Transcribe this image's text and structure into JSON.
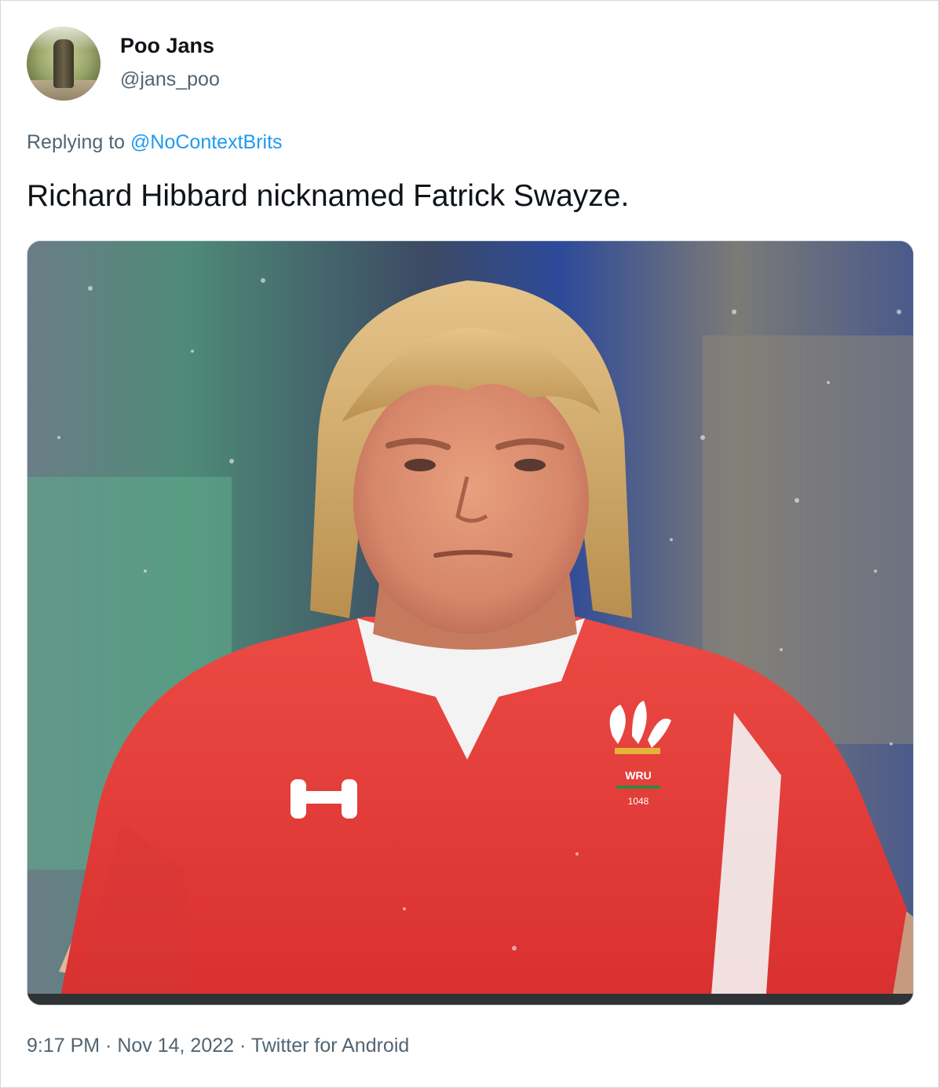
{
  "tweet": {
    "author": {
      "display_name": "Poo Jans",
      "handle": "@jans_poo"
    },
    "reply": {
      "prefix": "Replying to ",
      "mention": "@NoContextBrits"
    },
    "text": "Richard Hibbard nicknamed Fatrick Swayze.",
    "media": {
      "description_icon": "photo",
      "jersey_badge_text": "WRU",
      "jersey_badge_year": "1048"
    },
    "meta": {
      "time": "9:17 PM",
      "separator": " · ",
      "date": "Nov 14, 2022",
      "source": "Twitter for Android"
    }
  },
  "colors": {
    "text_primary": "#0f1419",
    "text_secondary": "#536471",
    "link": "#1d9bf0",
    "border": "#cfd9de",
    "jersey_red": "#e8403f"
  }
}
